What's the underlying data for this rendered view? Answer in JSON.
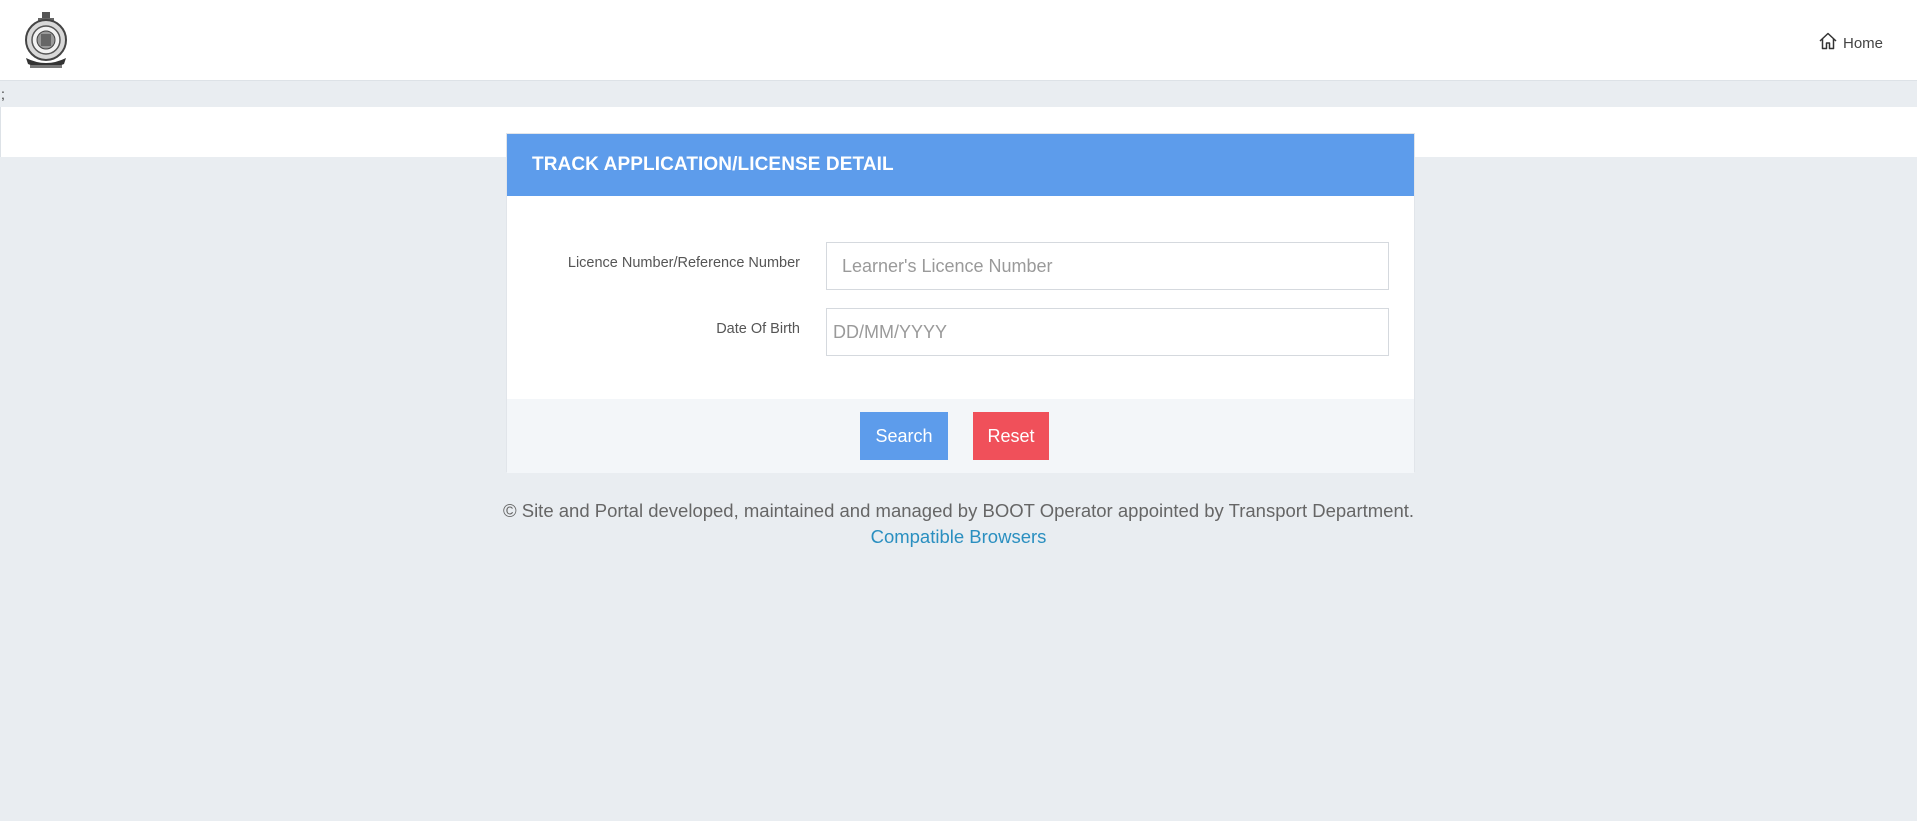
{
  "header": {
    "logo_icon": "state-emblem-icon",
    "home_icon": "home-icon",
    "home_label": "Home"
  },
  "stray_text": ";",
  "form": {
    "title": "TRACK APPLICATION/LICENSE DETAIL",
    "licence_label": "Licence Number/Reference Number",
    "licence_placeholder": "Learner's Licence Number",
    "licence_value": "",
    "dob_label": "Date Of Birth",
    "dob_placeholder": "DD/MM/YYYY",
    "dob_value": "",
    "search_label": "Search",
    "reset_label": "Reset"
  },
  "footer": {
    "copyright": "© Site and Portal developed, maintained and managed by BOOT Operator appointed by Transport Department.",
    "browsers_link": "Compatible Browsers"
  },
  "colors": {
    "header_blue": "#5d9ceb",
    "search_button": "#5d9ceb",
    "reset_button": "#f0505a",
    "link": "#2a8fc0",
    "page_background": "#e9edf1"
  }
}
